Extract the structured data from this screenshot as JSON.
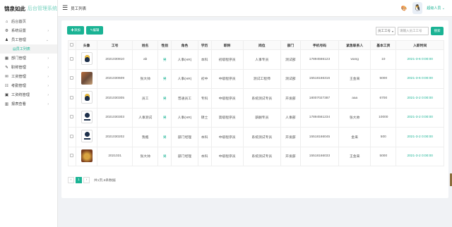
{
  "app": {
    "brand": "锦泉如此",
    "system_name": "后台管理系统"
  },
  "sidebar": {
    "items": [
      {
        "icon": "home-icon",
        "glyph": "⌂",
        "label": "后台首页",
        "arrow": ""
      },
      {
        "icon": "gear-icon",
        "glyph": "⚙",
        "label": "系统设置",
        "arrow": "›"
      },
      {
        "icon": "user-icon",
        "glyph": "♟",
        "label": "员工管理",
        "arrow": "⌄"
      },
      {
        "icon": "list-icon",
        "glyph": "▤",
        "label": "员工列表",
        "arrow": "",
        "sub": true
      },
      {
        "icon": "dept-icon",
        "glyph": "▦",
        "label": "部门管理",
        "arrow": "›"
      },
      {
        "icon": "job-icon",
        "glyph": "✎",
        "label": "职称管理",
        "arrow": "›"
      },
      {
        "icon": "salary-icon",
        "glyph": "✉",
        "label": "工资管理",
        "arrow": "›"
      },
      {
        "icon": "attendance-icon",
        "glyph": "☷",
        "label": "考勤管理",
        "arrow": "›"
      },
      {
        "icon": "contract-icon",
        "glyph": "▣",
        "label": "工资统管理",
        "arrow": "›"
      },
      {
        "icon": "report-icon",
        "glyph": "▥",
        "label": "报表查看",
        "arrow": "›"
      }
    ]
  },
  "header": {
    "breadcrumb": "员工列表",
    "user_name": "超级人员 ⌄"
  },
  "toolbar": {
    "add_label": "✚添加",
    "edit_label": "✎编辑",
    "select_value": "员工工号",
    "search_placeholder": "请输入员工工号",
    "search_label": "搜索"
  },
  "table": {
    "columns": [
      "",
      "头像",
      "工号",
      "姓名",
      "性别",
      "角色",
      "学历",
      "职称",
      "岗位",
      "部门",
      "手机号码",
      "紧急联系人",
      "基本工资",
      "入职时间"
    ],
    "rows": [
      {
        "avatar": "tux",
        "id": "2021030810",
        "name": "ab",
        "gender": "男",
        "role": "人事(HR)",
        "edu": "本科",
        "title": "初级程序员",
        "post": "人事专员",
        "dept": "测试部",
        "phone": "17894566123",
        "contact": "wang",
        "salary": "10",
        "date": "2021-3-6 0:00:00"
      },
      {
        "avatar": "photo1",
        "id": "2021030609",
        "name": "张大帅",
        "gender": "男",
        "role": "人事(HR)",
        "edu": "初中",
        "title": "中级程序员",
        "post": "测试工程师",
        "dept": "测试部",
        "phone": "15518166316",
        "contact": "王金来",
        "salary": "5000",
        "date": "2021-3-6 0:00:00"
      },
      {
        "avatar": "tux",
        "id": "2021030305",
        "name": "员工",
        "gender": "男",
        "role": "普通员工",
        "edu": "专科",
        "title": "中级程序员",
        "post": "系统测试专员",
        "dept": "开发部",
        "phone": "18007027387",
        "contact": "aaa",
        "salary": "6700",
        "date": "2021-3-2 0:00:00"
      },
      {
        "avatar": "logo",
        "id": "2021030303",
        "name": "人事测试",
        "gender": "男",
        "role": "人事(HR)",
        "edu": "硕士",
        "title": "高级程序员",
        "post": "薪酬专员",
        "dept": "人事部",
        "phone": "17894561234",
        "contact": "张大帅",
        "salary": "10000",
        "date": "2021-3-2 0:00:00"
      },
      {
        "avatar": "logo",
        "id": "2021030202",
        "name": "我瓶",
        "gender": "男",
        "role": "部门经理",
        "edu": "本科",
        "title": "中级程序员",
        "post": "系统测试专员",
        "dept": "开发部",
        "phone": "15518166045",
        "contact": "金来",
        "salary": "500",
        "date": "2021-3-2 0:00:00"
      },
      {
        "avatar": "food",
        "id": "2021031",
        "name": "张大帅",
        "gender": "男",
        "role": "部门经理",
        "edu": "本科",
        "title": "中级程序员",
        "post": "系统测试专员",
        "dept": "开发部",
        "phone": "15518166033",
        "contact": "王金来",
        "salary": "5000",
        "date": "2021-3-2 0:00:00"
      }
    ]
  },
  "pager": {
    "prev": "‹",
    "current": "1",
    "next": "›",
    "info": "共1页,6条数据"
  },
  "colors": {
    "accent": "#1ab394"
  }
}
